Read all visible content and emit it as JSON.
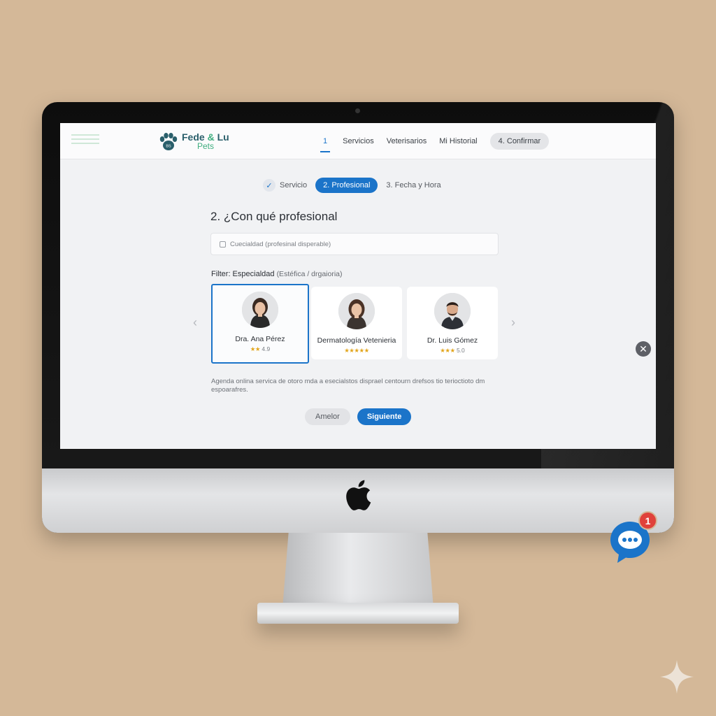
{
  "brand": {
    "name_part1": "Fede",
    "name_amp": "&",
    "name_part2": "Lu",
    "sub": "Pets",
    "paw_badge": "BS"
  },
  "nav": {
    "items": [
      "1",
      "Servicios",
      "Veterisarios",
      "Mi Historial"
    ],
    "active_index": 0,
    "cta": "4. Confirmar"
  },
  "stepper": {
    "step1": "Servicio",
    "step2": "2. Profesional",
    "step3": "3. Fecha y Hora"
  },
  "heading": "2. ¿Con qué profesional",
  "search": {
    "placeholder": "Cuecialdad (profesinal disperable)"
  },
  "filter": {
    "label": "Filter: Especialdad",
    "sub": "(Estéfica / drgaioria)"
  },
  "professionals": [
    {
      "name": "Dra. Ana Pérez",
      "stars": "★★",
      "score": "4.9",
      "selected": true
    },
    {
      "name": "Dermatología Vetenieria",
      "stars": "★★★★★",
      "score": "",
      "selected": false
    },
    {
      "name": "Dr. Luis Gómez",
      "stars": "★★★",
      "score": "5.0",
      "selected": false
    }
  ],
  "description": "Agenda onlina servica de otoro mda a esecialstos disprael centourn drefsos tio terioctioto dm espoarafres.",
  "buttons": {
    "prev": "Amelor",
    "next": "Siguiente"
  },
  "chat": {
    "badge": "1"
  },
  "colors": {
    "accent": "#1b74c9",
    "brand_teal": "#2a5f6b",
    "brand_green": "#3fae7f",
    "background": "#d4b898",
    "badge_red": "#e0413a"
  },
  "icons": [
    "paw-icon",
    "check-icon",
    "chevron-left-icon",
    "chevron-right-icon",
    "close-icon",
    "chat-icon",
    "apple-logo",
    "sparkle-icon"
  ]
}
